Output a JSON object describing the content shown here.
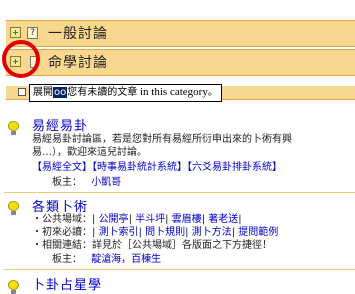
{
  "categories": [
    {
      "title": "一般討論"
    },
    {
      "title": "命學討論"
    }
  ],
  "tooltip": {
    "prefix": "展開",
    "highlight": "oo",
    "text": "您有未讀的文章",
    "en": " in this category",
    "suffix": "。"
  },
  "forums": [
    {
      "name": "易經易卦",
      "desc1": "易經易卦討論區，若是您對所有易經所衍申出來的卜術有興",
      "desc2": "易…），歡迎來這兒討論。",
      "links": [
        "【易經全文】",
        "【時事易卦統計系統】",
        "【六爻易卦排卦系統】"
      ],
      "moderator_label": "板主：",
      "moderator": "小凱哥"
    },
    {
      "name": "各類卜術",
      "l1_label": "・公共場域：",
      "l1_links": [
        "公開亭",
        "半斗坪",
        "雲眉樓",
        "著老送"
      ],
      "l2_label": "・初來必讀：",
      "l2_links": [
        "測卜索引",
        "問卜規則",
        "測卜方法",
        "提問範例"
      ],
      "l3": "・相關連結：詳見於［公共場域］各版面之下方捷徑！",
      "moderator_label": "板主：",
      "moderator": "靛滄海，百棟生"
    },
    {
      "name": "卜卦占星學"
    }
  ]
}
